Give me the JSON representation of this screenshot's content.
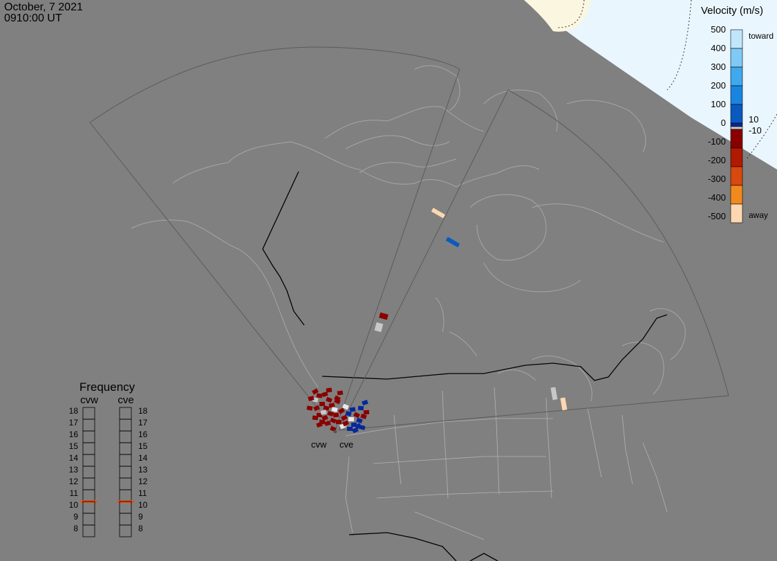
{
  "header": {
    "date": "October, 7 2021",
    "time": "0910:00 UT"
  },
  "colors": {
    "background": "#808080",
    "land_outline": "#a6a6a6",
    "border": "#000000",
    "fov_line": "#5a5a5a",
    "daylight": "#eaf6fd",
    "terminator": "#fbf6df",
    "gray_scatter": "#c8c8c8"
  },
  "velocity_scale": {
    "title": "Velocity (m/s)",
    "top_label": "toward",
    "bottom_label": "away",
    "ticks": [
      "500",
      "400",
      "300",
      "200",
      "100",
      "0",
      "-100",
      "-200",
      "-300",
      "-400",
      "-500"
    ],
    "inner_ticks": [
      "10",
      "-10"
    ],
    "colors": [
      "#bfe6fb",
      "#7fcaf5",
      "#3ea9ee",
      "#1a85e0",
      "#0a59bf",
      "#05289a",
      "#8a0000",
      "#b01a00",
      "#d9480e",
      "#f2891e",
      "#fcd7b0"
    ]
  },
  "frequency_panel": {
    "title": "Frequency",
    "radars": [
      {
        "name": "cvw",
        "active": "11"
      },
      {
        "name": "cve",
        "active": "11"
      }
    ],
    "levels": [
      "18",
      "17",
      "16",
      "15",
      "14",
      "13",
      "12",
      "11",
      "10",
      "9",
      "8"
    ],
    "active_color": "#e0501a"
  },
  "radars": {
    "cvw_label": "cvw",
    "cve_label": "cve"
  }
}
